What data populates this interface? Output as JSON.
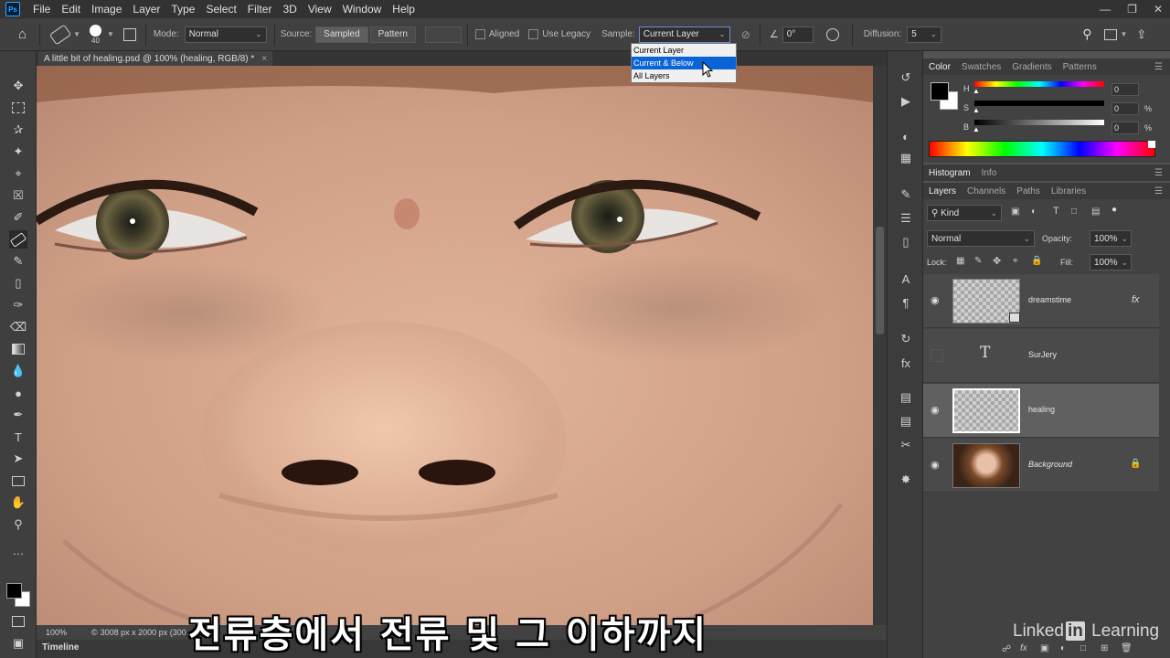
{
  "app": {
    "logo": "Ps"
  },
  "menu": [
    "File",
    "Edit",
    "Image",
    "Layer",
    "Type",
    "Select",
    "Filter",
    "3D",
    "View",
    "Window",
    "Help"
  ],
  "options": {
    "brush_size": "40",
    "mode_label": "Mode:",
    "mode_value": "Normal",
    "source_label": "Source:",
    "sampled": "Sampled",
    "pattern": "Pattern",
    "aligned": "Aligned",
    "use_legacy": "Use Legacy",
    "sample_label": "Sample:",
    "sample_value": "Current Layer",
    "angle_value": "0°",
    "diffusion_label": "Diffusion:",
    "diffusion_value": "5"
  },
  "sample_menu": {
    "options": [
      "Current Layer",
      "Current & Below",
      "All Layers"
    ],
    "highlighted": "Current & Below"
  },
  "document": {
    "tab_title": "A little bit of healing.psd @ 100% (healing, RGB/8) *",
    "zoom": "100%",
    "doc_size": "3008 px x 2000 px (300"
  },
  "timeline_label": "Timeline",
  "subtitle": "전류층에서 전류 및 그 이하까지",
  "color_panel": {
    "tabs": [
      "Color",
      "Swatches",
      "Gradients",
      "Patterns"
    ],
    "channels": [
      {
        "label": "H",
        "value": "0",
        "unit": ""
      },
      {
        "label": "S",
        "value": "0",
        "unit": "%"
      },
      {
        "label": "B",
        "value": "0",
        "unit": "%"
      }
    ]
  },
  "histogram_tabs": [
    "Histogram",
    "Info"
  ],
  "layers_panel": {
    "tabs": [
      "Layers",
      "Channels",
      "Paths",
      "Libraries"
    ],
    "filter_kind": "Kind",
    "blend_mode": "Normal",
    "opacity_label": "Opacity:",
    "opacity": "100%",
    "lock_label": "Lock:",
    "fill_label": "Fill:",
    "fill": "100%",
    "layers": [
      {
        "name": "dreamstime",
        "visible": true,
        "type": "smart",
        "fx": "fx"
      },
      {
        "name": "SurJery",
        "visible": false,
        "type": "text"
      },
      {
        "name": "healing",
        "visible": true,
        "type": "pixel",
        "selected": true
      },
      {
        "name": "Background",
        "visible": true,
        "type": "photo",
        "locked": true
      }
    ]
  },
  "watermark": {
    "pre": "Linked",
    "box": "in",
    "post": " Learning"
  }
}
